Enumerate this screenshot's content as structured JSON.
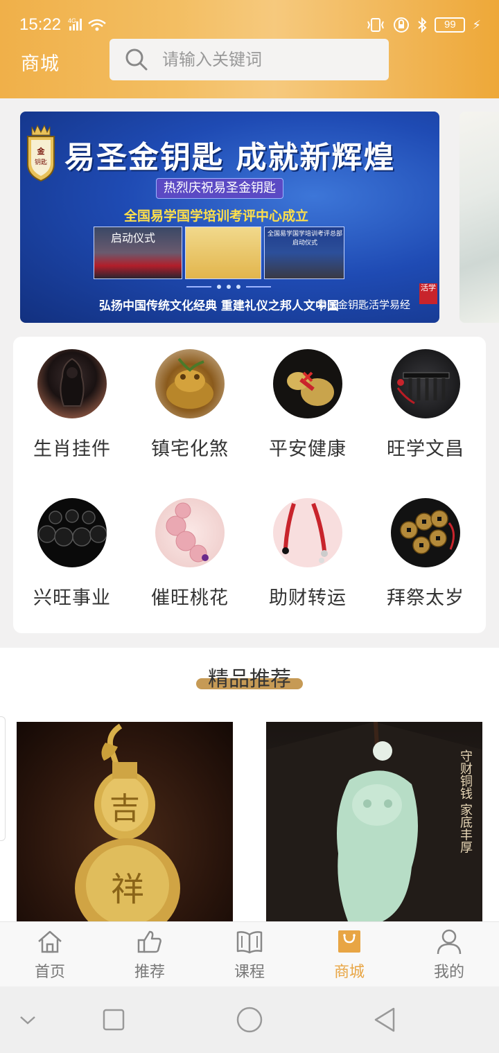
{
  "status": {
    "time": "15:22",
    "network": "4G",
    "battery": "99"
  },
  "header": {
    "title": "商城",
    "search_placeholder": "请输入关键词"
  },
  "banner": {
    "crest_text": "金钥匙",
    "headline": "易圣金钥匙 成就新辉煌",
    "chip": "热烈庆祝易圣金钥匙",
    "line2": "全国易学国学培训考评中心成立",
    "photo1_caption": "启动仪式",
    "photo3_caption": "全国易学国学培训考评总部 启动仪式",
    "bottom_text": "弘扬中国传统文化经典   重建礼仪之邦人文中国",
    "watermark": "易圣金钥匙活学易经",
    "stamp": "活学"
  },
  "categories": [
    {
      "label": "生肖挂件",
      "icon": "jade-pendant-icon"
    },
    {
      "label": "镇宅化煞",
      "icon": "golden-toad-icon"
    },
    {
      "label": "平安健康",
      "icon": "gourd-icon"
    },
    {
      "label": "旺学文昌",
      "icon": "brush-rack-icon"
    },
    {
      "label": "兴旺事业",
      "icon": "black-beads-icon"
    },
    {
      "label": "催旺桃花",
      "icon": "pink-beads-icon"
    },
    {
      "label": "助财转运",
      "icon": "red-string-icon"
    },
    {
      "label": "拜祭太岁",
      "icon": "coins-icon"
    }
  ],
  "recommend": {
    "title": "精品推荐",
    "products": [
      {
        "name": "gold-gourd",
        "overlay": "吉祥"
      },
      {
        "name": "jade-pendant",
        "overlay": "守财铜钱 家底丰厚"
      }
    ]
  },
  "nav": [
    {
      "label": "首页",
      "icon": "home-icon"
    },
    {
      "label": "推荐",
      "icon": "thumbs-up-icon"
    },
    {
      "label": "课程",
      "icon": "book-icon"
    },
    {
      "label": "商城",
      "icon": "shopping-bag-icon",
      "active": true
    },
    {
      "label": "我的",
      "icon": "person-icon"
    }
  ],
  "colors": {
    "header": "#f2b655",
    "accent": "#e8a544",
    "banner": "#1f4bb4"
  }
}
